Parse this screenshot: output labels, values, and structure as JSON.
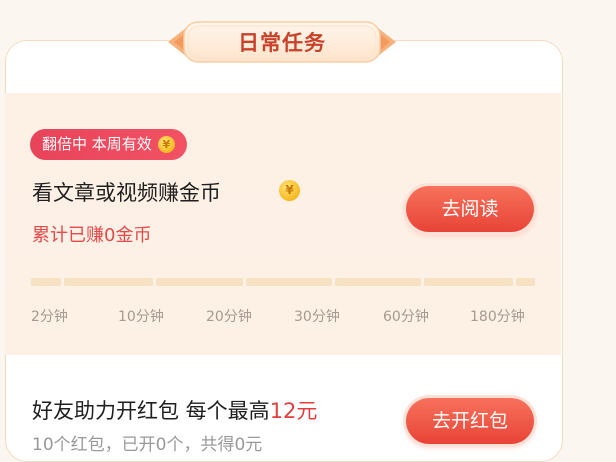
{
  "header": {
    "title": "日常任务"
  },
  "reading_task": {
    "badge_text": "翻倍中 本周有效",
    "title": "看文章或视频赚金币",
    "earned_text": "累计已赚0金币",
    "button_label": "去阅读",
    "progress": 0,
    "milestones": [
      "2分钟",
      "10分钟",
      "20分钟",
      "30分钟",
      "60分钟",
      "180分钟"
    ]
  },
  "friend_task": {
    "title_prefix": "好友助力开红包 每个最高",
    "amount": "12元",
    "subtitle": "10个红包，已开0个，共得0元",
    "button_label": "去开红包"
  },
  "colors": {
    "accent_red": "#e84336",
    "badge_red": "#e8435a",
    "coin_gold": "#f6b91d",
    "progress_track": "#f6e2c2"
  },
  "icons": {
    "coin": "coin-icon"
  }
}
